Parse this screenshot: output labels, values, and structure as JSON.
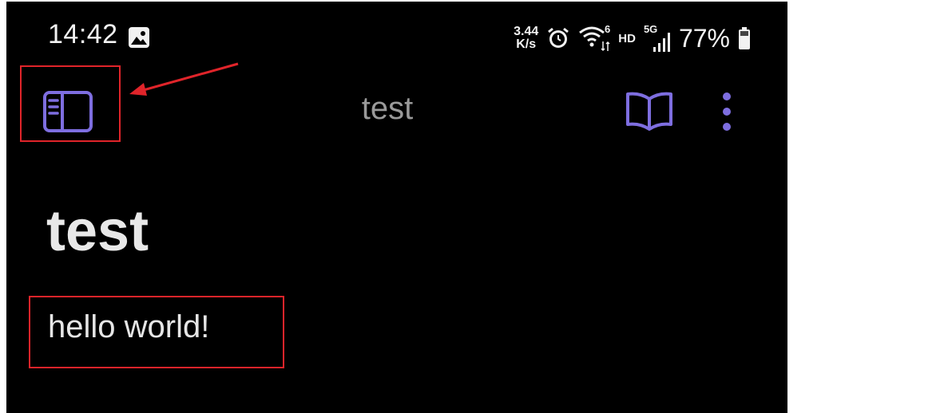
{
  "status_bar": {
    "time": "14:42",
    "net_speed_value": "3.44",
    "net_speed_unit": "K/s",
    "network_type": "HD",
    "mobile_generation": "5G",
    "wifi_generation": "6",
    "battery_percent": "77%"
  },
  "app_bar": {
    "note_title": "test"
  },
  "note": {
    "heading": "test",
    "body": "hello world!"
  },
  "colors": {
    "accent": "#7e6ee0",
    "background": "#000000",
    "annotation": "#e0242a"
  }
}
